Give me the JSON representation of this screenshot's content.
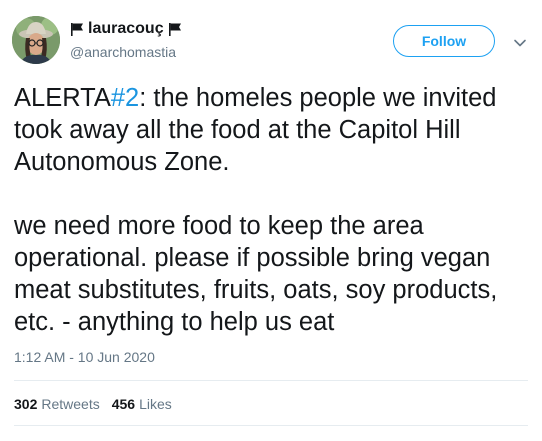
{
  "user": {
    "display_name": "lauracouç",
    "handle": "@anarchomastia"
  },
  "follow_button": {
    "label": "Follow"
  },
  "tweet": {
    "text_before_hashtag": "ALERTA",
    "hashtag": "#2",
    "text_after_hashtag": ": the homeles people we invited took away all the food at the Capitol Hill Autonomous Zone.\n\nwe need more food to keep the area operational. please if possible bring vegan meat substitutes, fruits, oats, soy products, etc. - anything to help us eat",
    "timestamp": "1:12 AM - 10 Jun 2020"
  },
  "stats": {
    "retweets_count": "302",
    "retweets_label": "Retweets",
    "likes_count": "456",
    "likes_label": "Likes"
  },
  "icons": {
    "flag": "black-flag-icon",
    "caret": "chevron-down-icon"
  },
  "colors": {
    "accent": "#1da1f2",
    "hashtag": "#1b95e0",
    "secondary_text": "#657786",
    "primary_text": "#14171a"
  }
}
